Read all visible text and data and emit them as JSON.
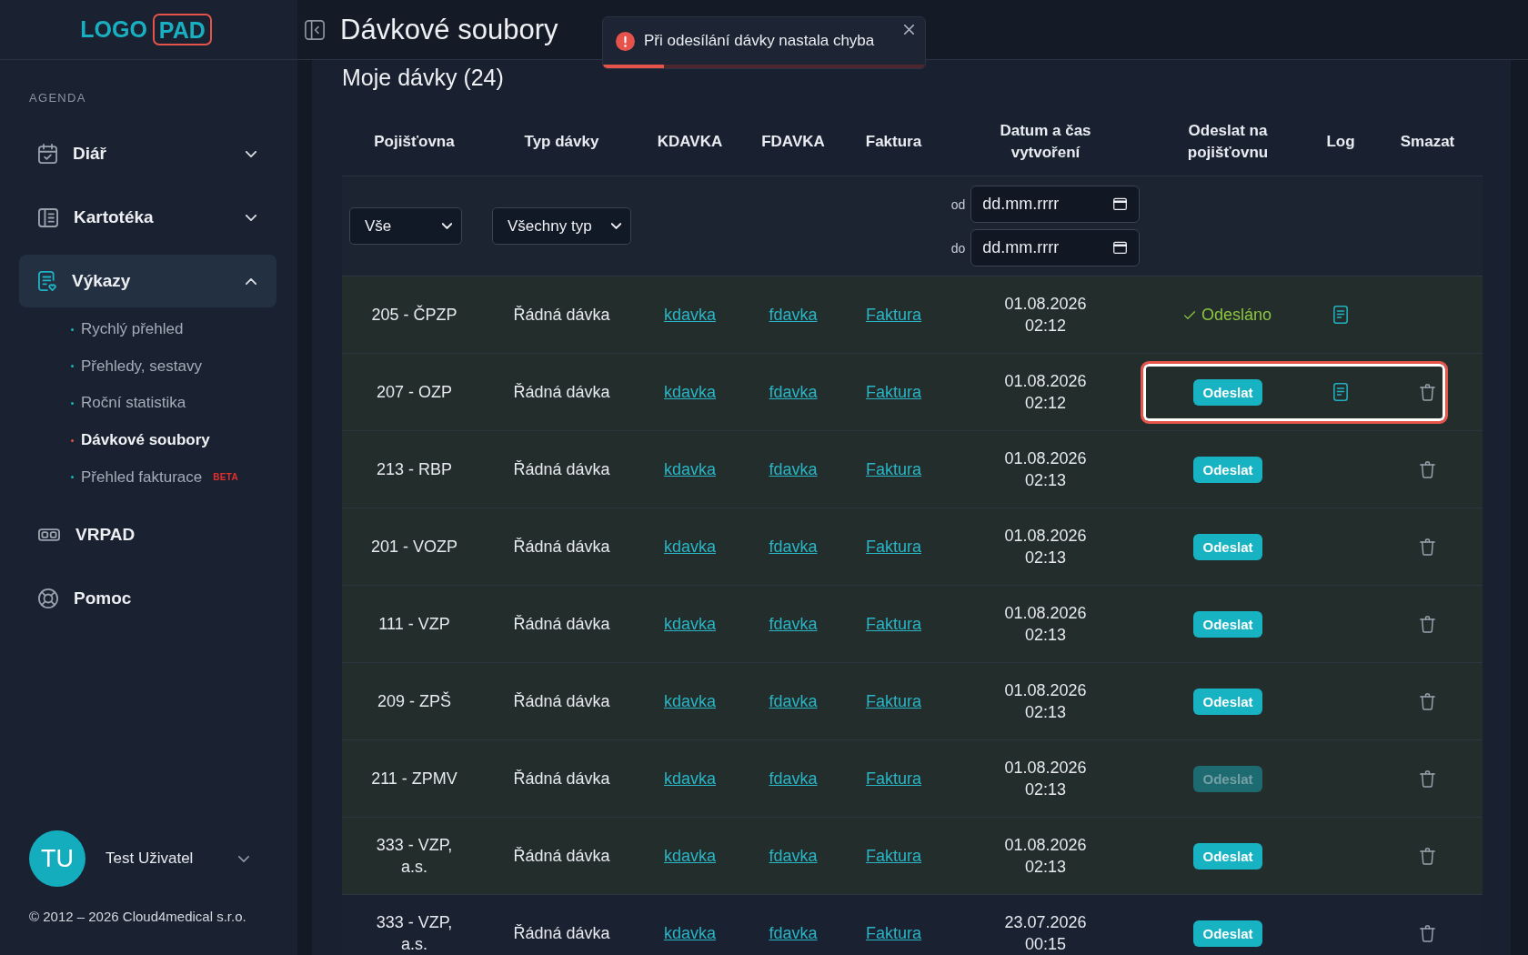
{
  "sidebar": {
    "logo": {
      "text": "LOGO",
      "boxed_text": "PAD"
    },
    "section_label": "AGENDA",
    "items": [
      {
        "kind": "group",
        "label": "Diář",
        "selected": false,
        "expanded": false
      },
      {
        "kind": "group",
        "label": "Kartotéka",
        "selected": false,
        "expanded": false
      },
      {
        "kind": "group",
        "label": "Výkazy",
        "selected": true,
        "expanded": true,
        "children": [
          {
            "label": "Rychlý přehled",
            "selected": false
          },
          {
            "label": "Přehledy, sestavy",
            "selected": false
          },
          {
            "label": "Roční statistika",
            "selected": false
          },
          {
            "label": "Dávkové soubory",
            "selected": true
          },
          {
            "label": "Přehled fakturace",
            "selected": false,
            "badge": "BETA"
          }
        ]
      },
      {
        "kind": "link",
        "label": "VRPAD",
        "selected": false
      },
      {
        "kind": "link",
        "label": "Pomoc",
        "selected": false
      }
    ],
    "user": {
      "initials": "TU",
      "name": "Test Uživatel"
    },
    "copyright": "© 2012 – 2026 Cloud4medical s.r.o."
  },
  "header": {
    "title": "Dávkové soubory"
  },
  "toast": {
    "kind": "error",
    "message": "Při odesílání dávky nastala chyba",
    "level": 0.19
  },
  "panel": {
    "title": "Moje dávky (24)",
    "table": {
      "columns": [
        "Pojišťovna",
        "Typ dávky",
        "KDAVKA",
        "FDAVKA",
        "Faktura",
        "Datum a čas vytvoření",
        "Odeslat na pojišťovnu",
        "Log",
        "Smazat"
      ],
      "filters": {
        "insurer": {
          "value": "Vše"
        },
        "type": {
          "value": "Všechny typ"
        },
        "created_from": {
          "label": "od",
          "placeholder": "dd.mm.rrrr"
        },
        "created_to": {
          "label": "do",
          "placeholder": "dd.mm.rrrr"
        }
      },
      "rows": [
        {
          "insurer": "205 - ČPZP",
          "type": "Řádná dávka",
          "kdavka": "kdavka",
          "fdavka": "fdavka",
          "invoice": "Faktura",
          "created": "01.08.2026 02:12",
          "send": {
            "kind": "status",
            "label": "Odesláno"
          },
          "log": true,
          "deletable": false,
          "highlighted": true,
          "framed": false
        },
        {
          "insurer": "207 - OZP",
          "type": "Řádná dávka",
          "kdavka": "kdavka",
          "fdavka": "fdavka",
          "invoice": "Faktura",
          "created": "01.08.2026 02:12",
          "send": {
            "kind": "button",
            "label": "Odeslat",
            "disabled": false
          },
          "log": true,
          "deletable": true,
          "highlighted": true,
          "framed": true
        },
        {
          "insurer": "213 - RBP",
          "type": "Řádná dávka",
          "kdavka": "kdavka",
          "fdavka": "fdavka",
          "invoice": "Faktura",
          "created": "01.08.2026 02:13",
          "send": {
            "kind": "button",
            "label": "Odeslat",
            "disabled": false
          },
          "log": false,
          "deletable": true,
          "highlighted": true,
          "framed": false
        },
        {
          "insurer": "201 - VOZP",
          "type": "Řádná dávka",
          "kdavka": "kdavka",
          "fdavka": "fdavka",
          "invoice": "Faktura",
          "created": "01.08.2026 02:13",
          "send": {
            "kind": "button",
            "label": "Odeslat",
            "disabled": false
          },
          "log": false,
          "deletable": true,
          "highlighted": true,
          "framed": false
        },
        {
          "insurer": "111 - VZP",
          "type": "Řádná dávka",
          "kdavka": "kdavka",
          "fdavka": "fdavka",
          "invoice": "Faktura",
          "created": "01.08.2026 02:13",
          "send": {
            "kind": "button",
            "label": "Odeslat",
            "disabled": false
          },
          "log": false,
          "deletable": true,
          "highlighted": true,
          "framed": false
        },
        {
          "insurer": "209 - ZPŠ",
          "type": "Řádná dávka",
          "kdavka": "kdavka",
          "fdavka": "fdavka",
          "invoice": "Faktura",
          "created": "01.08.2026 02:13",
          "send": {
            "kind": "button",
            "label": "Odeslat",
            "disabled": false
          },
          "log": false,
          "deletable": true,
          "highlighted": true,
          "framed": false
        },
        {
          "insurer": "211 - ZPMV",
          "type": "Řádná dávka",
          "kdavka": "kdavka",
          "fdavka": "fdavka",
          "invoice": "Faktura",
          "created": "01.08.2026 02:13",
          "send": {
            "kind": "button",
            "label": "Odeslat",
            "disabled": true
          },
          "log": false,
          "deletable": true,
          "highlighted": true,
          "framed": false
        },
        {
          "insurer": "333 - VZP, a.s.",
          "type": "Řádná dávka",
          "kdavka": "kdavka",
          "fdavka": "fdavka",
          "invoice": "Faktura",
          "created": "01.08.2026 02:13",
          "send": {
            "kind": "button",
            "label": "Odeslat",
            "disabled": false
          },
          "log": false,
          "deletable": true,
          "highlighted": true,
          "framed": false
        },
        {
          "insurer": "333 - VZP, a.s.",
          "type": "Řádná dávka",
          "kdavka": "kdavka",
          "fdavka": "fdavka",
          "invoice": "Faktura",
          "created": "23.07.2026 00:15",
          "send": {
            "kind": "button",
            "label": "Odeslat",
            "disabled": false
          },
          "log": false,
          "deletable": true,
          "highlighted": false,
          "framed": false
        }
      ]
    }
  }
}
